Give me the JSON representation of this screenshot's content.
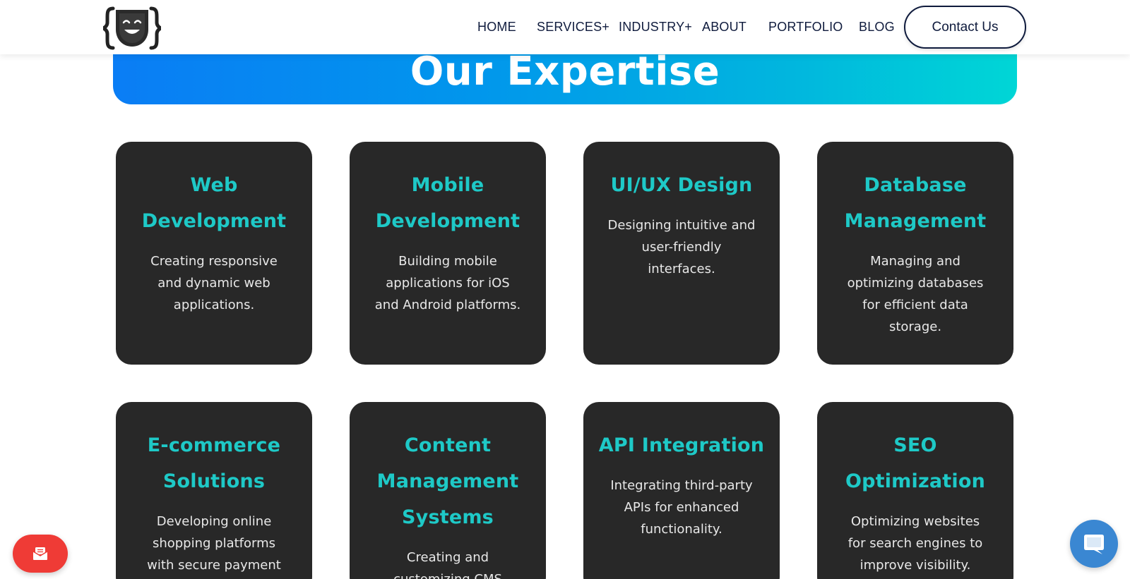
{
  "header": {
    "logo_name": "smiling-mask-brace-logo",
    "nav": [
      "HOME",
      "SERVICES+",
      "INDUSTRY+",
      "ABOUT",
      "PORTFOLIO",
      "BLOG"
    ],
    "contact_label": "Contact Us"
  },
  "banner": {
    "title": "Our Expertise"
  },
  "cards": [
    {
      "title": [
        "Web",
        "Development"
      ],
      "desc": [
        "Creating responsive",
        "and dynamic web",
        "applications."
      ]
    },
    {
      "title": [
        "Mobile",
        "Development"
      ],
      "desc": [
        "Building mobile",
        "applications for iOS",
        "and Android platforms."
      ]
    },
    {
      "title": [
        "UI/UX Design"
      ],
      "desc": [
        "Designing intuitive and",
        "user-friendly",
        "interfaces."
      ]
    },
    {
      "title": [
        "Database",
        "Management"
      ],
      "desc": [
        "Managing and",
        "optimizing databases",
        "for efficient data",
        "storage."
      ]
    },
    {
      "title": [
        "E-commerce",
        "Solutions"
      ],
      "desc": [
        "Developing online",
        "shopping platforms",
        "with secure payment"
      ]
    },
    {
      "title": [
        "Content",
        "Management",
        "Systems"
      ],
      "desc": [
        "Creating and",
        "customizing CMS"
      ]
    },
    {
      "title": [
        "API Integration"
      ],
      "desc": [
        "Integrating third-party",
        "APIs for enhanced",
        "functionality."
      ]
    },
    {
      "title": [
        "SEO",
        "Optimization"
      ],
      "desc": [
        "Optimizing websites",
        "for search engines to",
        "improve visibility."
      ]
    }
  ],
  "floating": {
    "left_icon": "envelope-icon",
    "right_icon": "chat-bubble-icon"
  },
  "colors": {
    "accent_teal": "#1ec9c7",
    "card_bg": "#282828",
    "nav_text": "#0f1b3d",
    "banner_start": "#0a7df5",
    "banner_end": "#00d6d6",
    "float_red": "#ef3b36",
    "float_blue": "#3a87d2"
  }
}
